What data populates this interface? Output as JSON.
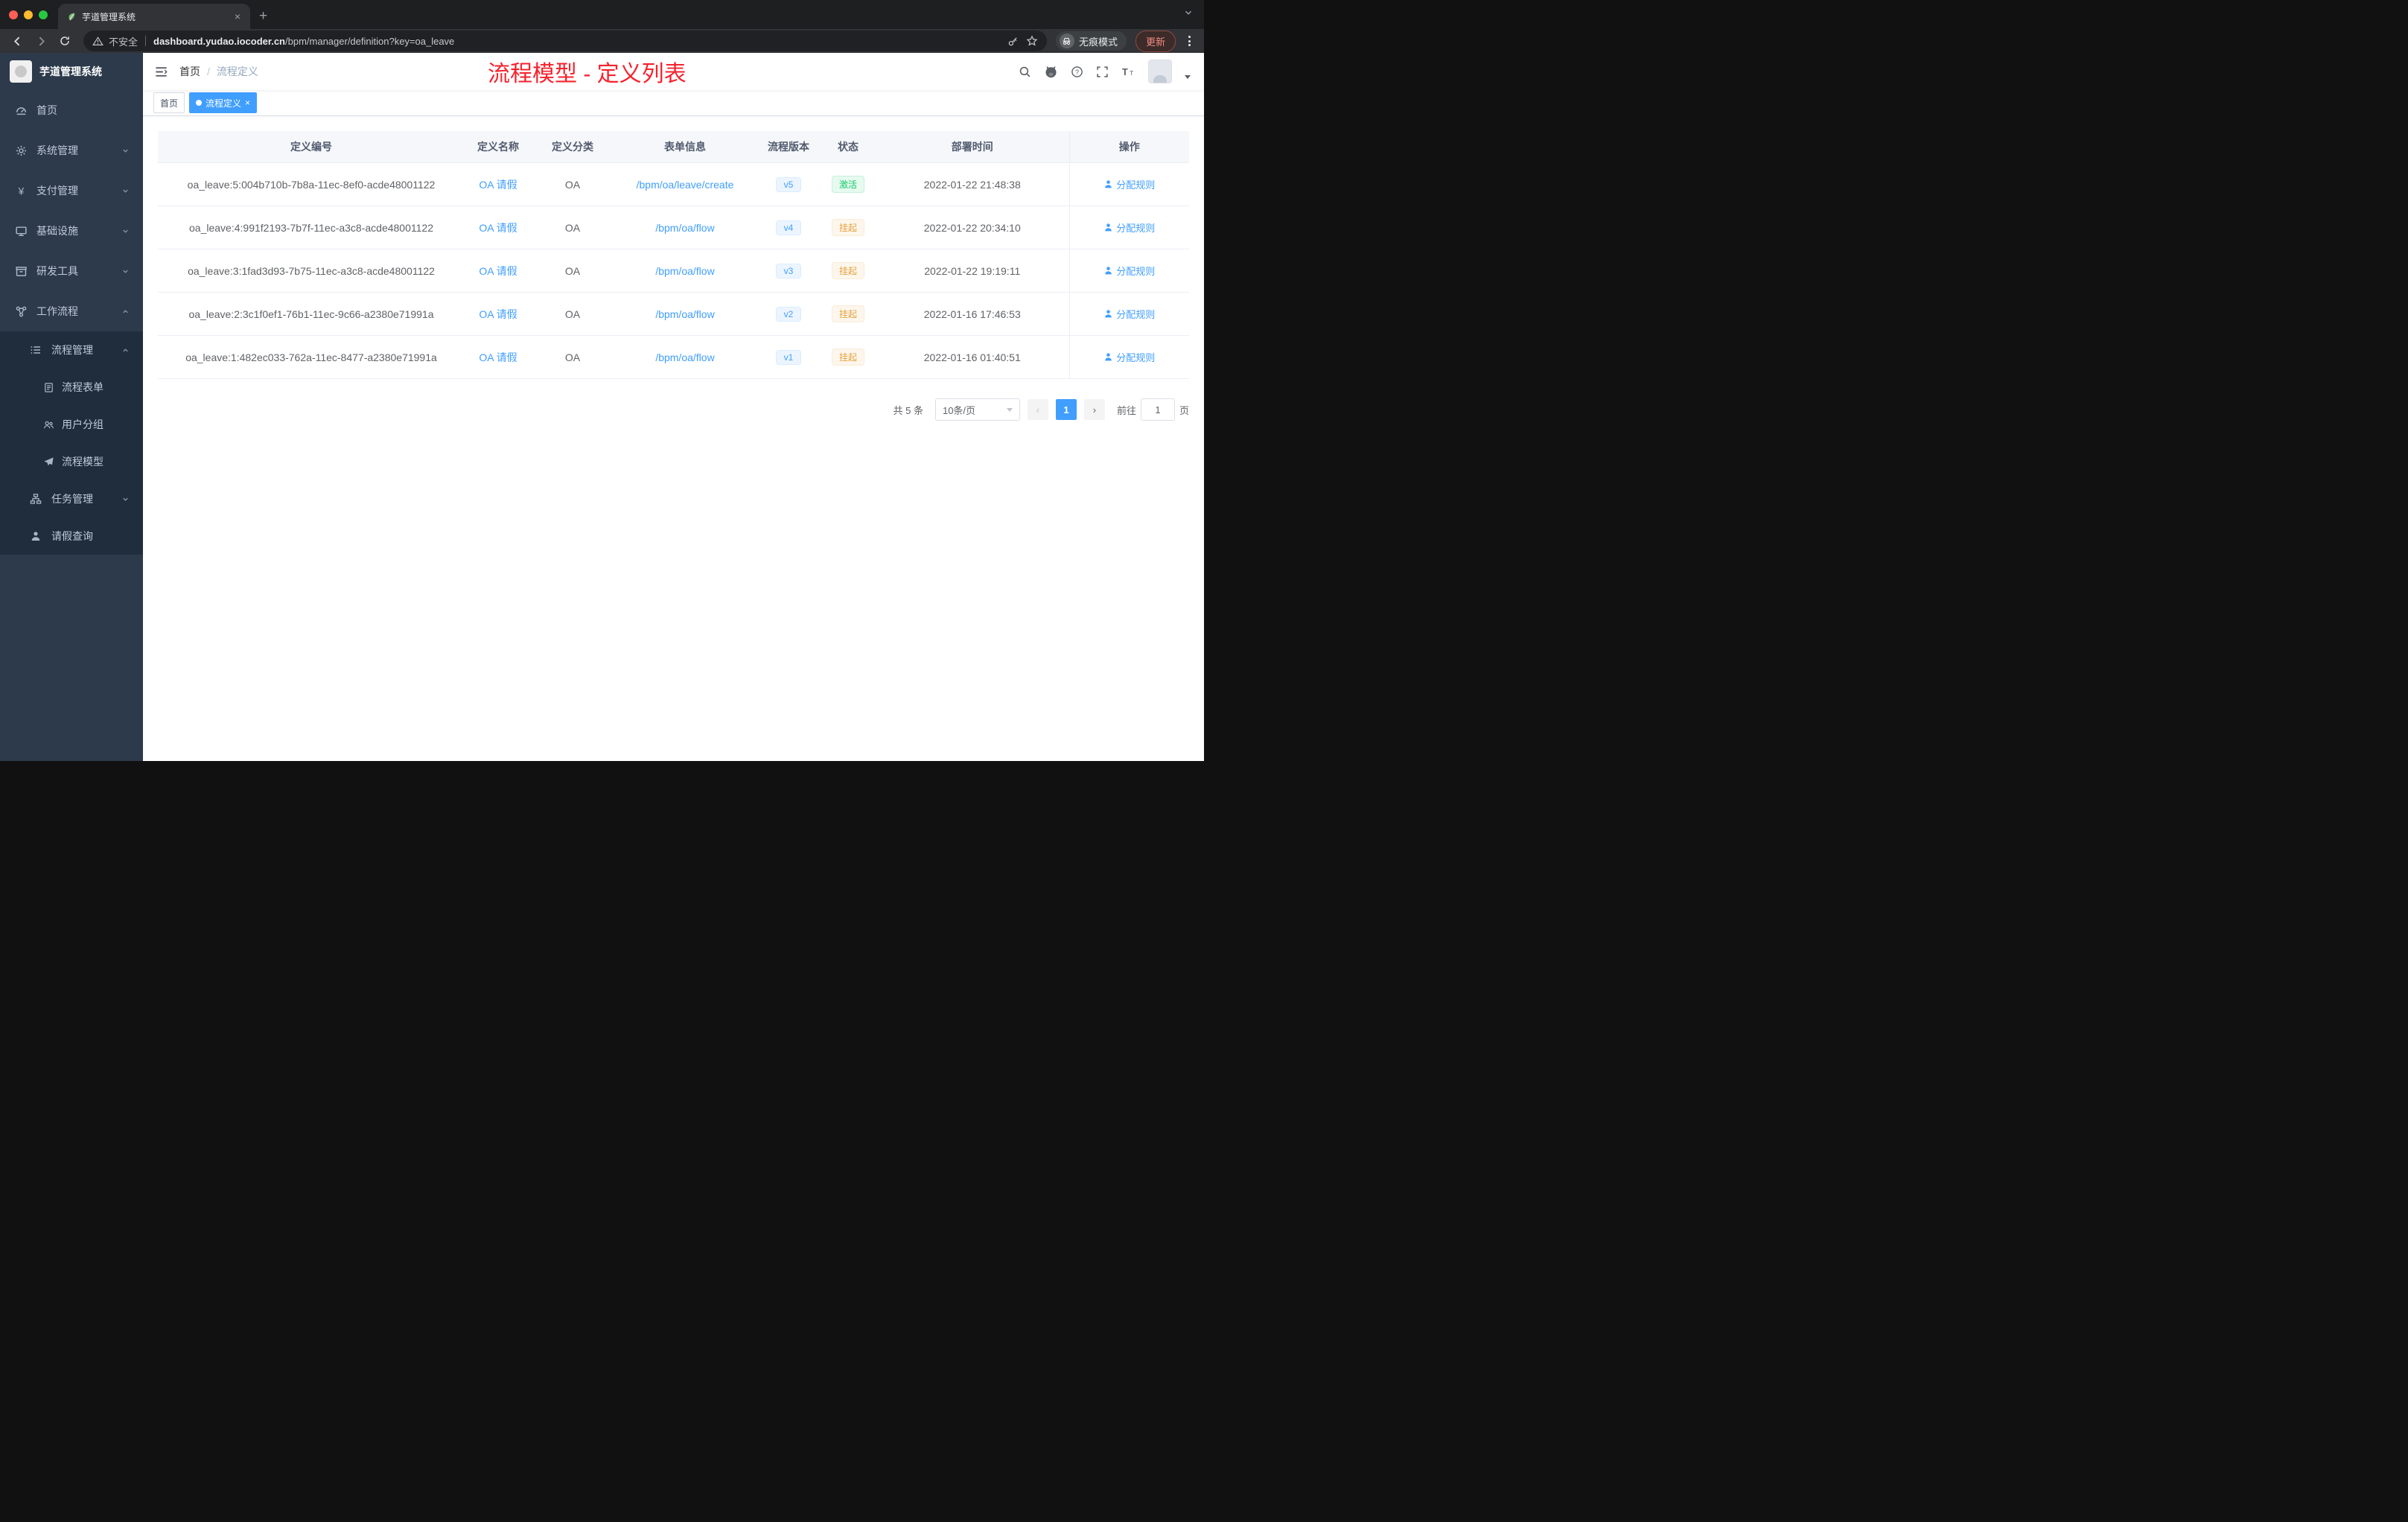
{
  "colors": {
    "accent": "#409eff",
    "success": "#13ce66",
    "warning": "#e6a23c",
    "annotation_red": "#f5222d",
    "update_text": "#f28b82",
    "sidebar_bg": "#2d3a4b",
    "submenu_bg": "#1f2d3d"
  },
  "chrome": {
    "tab_title": "芋道管理系统",
    "tab_close": "×",
    "new_tab": "+",
    "security_label": "不安全",
    "url_host": "dashboard.yudao.iocoder.cn",
    "url_path": "/bpm/manager/definition?key=oa_leave",
    "incognito_label": "无痕模式",
    "update_label": "更新"
  },
  "icons": [
    "seedling-favicon-icon",
    "back-icon",
    "forward-icon",
    "reload-icon",
    "warning-icon",
    "key-icon",
    "star-icon",
    "incognito-icon",
    "browser-menu-icon",
    "hamburger-icon",
    "search-icon",
    "github-icon",
    "question-icon",
    "fullscreen-icon",
    "font-size-icon",
    "dashboard-icon",
    "gear-icon",
    "yen-icon",
    "monitor-icon",
    "toolbox-icon",
    "workflow-icon",
    "list-icon",
    "form-icon",
    "user-group-icon",
    "send-icon",
    "tree-icon",
    "person-icon",
    "user-icon",
    "chevron-down-icon",
    "chevron-up-icon"
  ],
  "sidebar": {
    "logo_title": "芋道管理系统",
    "menu": [
      {
        "label": "首页",
        "icon": "dashboard-icon"
      },
      {
        "label": "系统管理",
        "icon": "gear-icon"
      },
      {
        "label": "支付管理",
        "icon": "yen-icon"
      },
      {
        "label": "基础设施",
        "icon": "monitor-icon"
      },
      {
        "label": "研发工具",
        "icon": "toolbox-icon"
      },
      {
        "label": "工作流程",
        "icon": "workflow-icon"
      }
    ],
    "submenu": [
      {
        "label": "流程管理",
        "icon": "list-icon"
      },
      {
        "label": "流程表单",
        "icon": "form-icon"
      },
      {
        "label": "用户分组",
        "icon": "user-group-icon"
      },
      {
        "label": "流程模型",
        "icon": "send-icon"
      },
      {
        "label": "任务管理",
        "icon": "tree-icon"
      },
      {
        "label": "请假查询",
        "icon": "person-icon"
      }
    ]
  },
  "navbar": {
    "breadcrumb_home": "首页",
    "breadcrumb_sep": "/",
    "breadcrumb_current": "流程定义",
    "annotation": "流程模型 - 定义列表"
  },
  "tags": {
    "home": "首页",
    "current": "流程定义",
    "close": "×"
  },
  "table": {
    "headers": [
      "定义编号",
      "定义名称",
      "定义分类",
      "表单信息",
      "流程版本",
      "状态",
      "部署时间",
      "操作"
    ],
    "rows": [
      {
        "id": "oa_leave:5:004b710b-7b8a-11ec-8ef0-acde48001122",
        "name": "OA 请假",
        "category": "OA",
        "form": "/bpm/oa/leave/create",
        "version": "v5",
        "status": "激活",
        "status_type": "success",
        "deploy_time": "2022-01-22 21:48:38",
        "action": "分配规则"
      },
      {
        "id": "oa_leave:4:991f2193-7b7f-11ec-a3c8-acde48001122",
        "name": "OA 请假",
        "category": "OA",
        "form": "/bpm/oa/flow",
        "version": "v4",
        "status": "挂起",
        "status_type": "warning",
        "deploy_time": "2022-01-22 20:34:10",
        "action": "分配规则"
      },
      {
        "id": "oa_leave:3:1fad3d93-7b75-11ec-a3c8-acde48001122",
        "name": "OA 请假",
        "category": "OA",
        "form": "/bpm/oa/flow",
        "version": "v3",
        "status": "挂起",
        "status_type": "warning",
        "deploy_time": "2022-01-22 19:19:11",
        "action": "分配规则"
      },
      {
        "id": "oa_leave:2:3c1f0ef1-76b1-11ec-9c66-a2380e71991a",
        "name": "OA 请假",
        "category": "OA",
        "form": "/bpm/oa/flow",
        "version": "v2",
        "status": "挂起",
        "status_type": "warning",
        "deploy_time": "2022-01-16 17:46:53",
        "action": "分配规则"
      },
      {
        "id": "oa_leave:1:482ec033-762a-11ec-8477-a2380e71991a",
        "name": "OA 请假",
        "category": "OA",
        "form": "/bpm/oa/flow",
        "version": "v1",
        "status": "挂起",
        "status_type": "warning",
        "deploy_time": "2022-01-16 01:40:51",
        "action": "分配规则"
      }
    ]
  },
  "pagination": {
    "total": "共 5 条",
    "page_size": "10条/页",
    "prev": "‹",
    "page": "1",
    "next": "›",
    "goto_label": "前往",
    "goto_value": "1",
    "goto_unit": "页"
  }
}
